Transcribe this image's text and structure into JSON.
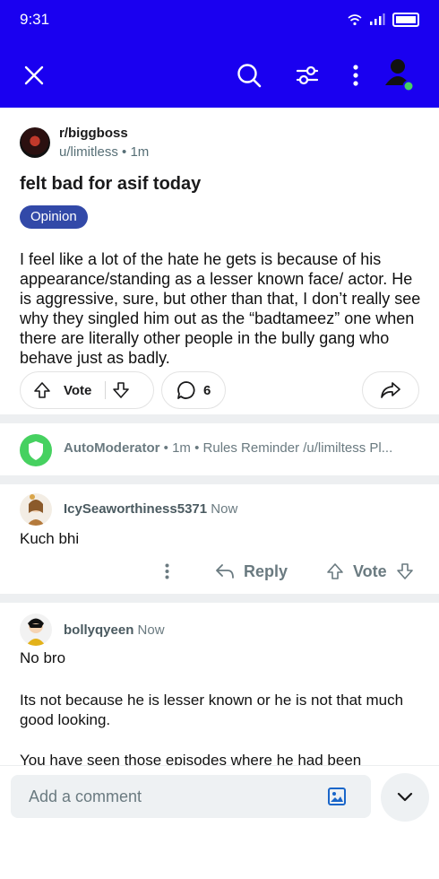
{
  "status_bar": {
    "time": "9:31"
  },
  "post": {
    "subreddit": "r/biggboss",
    "author": "u/limitless",
    "age": "1m",
    "title": "felt bad for asif today",
    "flair": "Opinion",
    "body": "I feel like a lot of the hate he gets is because of his appearance/standing as a lesser known face/ actor. He is aggressive, sure, but other than that, I don’t really see why they singled him out as the “badtameez” one when there are literally other people in the bully gang who behave just as badly.",
    "vote_label": "Vote",
    "comment_count": "6"
  },
  "automod": {
    "name": "AutoModerator",
    "age": "1m",
    "preview": "Rules Reminder /u/limiltess Pl..."
  },
  "comments": [
    {
      "author": "IcySeaworthiness5371",
      "time": "Now",
      "body": "Kuch bhi",
      "reply_label": "Reply",
      "vote_label": "Vote"
    },
    {
      "author": "bollyqyeen",
      "time": "Now",
      "line1": "No bro",
      "line2": "Its not because he is lesser known or he is not that much good looking.",
      "line3": "You have seen those episodes where he had been"
    }
  ],
  "composer": {
    "placeholder": "Add a comment"
  },
  "colors": {
    "brand": "#1a00f0",
    "flair": "#3249a8",
    "automod": "#46d160",
    "online": "#46d160"
  }
}
